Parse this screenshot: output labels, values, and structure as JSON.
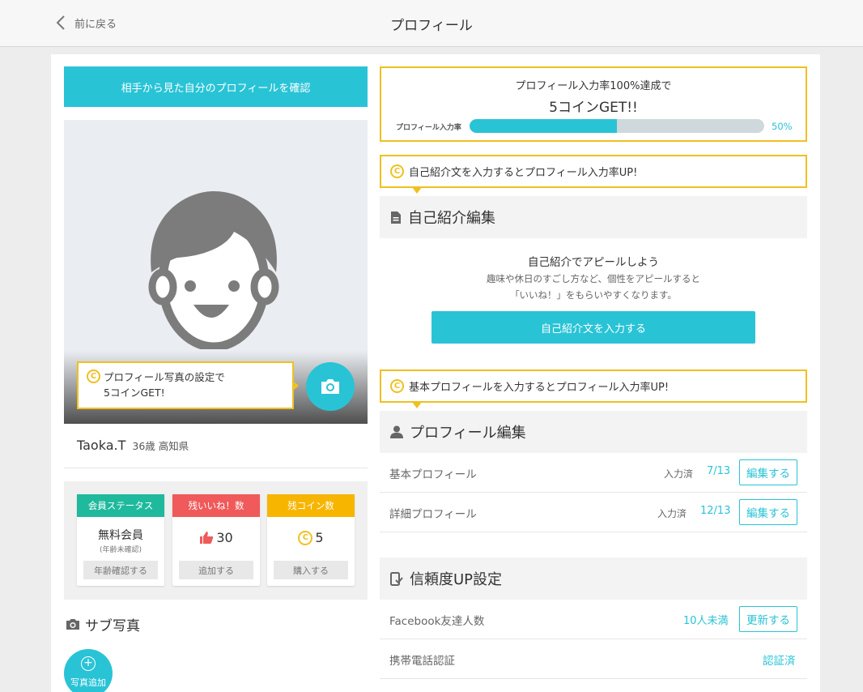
{
  "header": {
    "back_label": "前に戻る",
    "title": "プロフィール"
  },
  "left": {
    "view_profile_button": "相手から見た自分のプロフィールを確認",
    "photo_tip": {
      "line1": "プロフィール写真の設定で",
      "line2": "5コインGET!"
    },
    "user": {
      "name": "Taoka.T",
      "age_location": "36歳 高知県"
    },
    "stats": [
      {
        "header": "会員ステータス",
        "value": "無料会員",
        "sub": "(年齢未確認)",
        "action": "年齢確認する",
        "color": "#1fb99d"
      },
      {
        "header": "残いいね！数",
        "value": "30",
        "action": "追加する",
        "color": "#f05a5a"
      },
      {
        "header": "残コイン数",
        "value": "5",
        "action": "購入する",
        "color": "#f7b500"
      }
    ],
    "sub_photo_title": "サブ写真",
    "add_photo_label": "写真追加"
  },
  "right": {
    "progress": {
      "line1": "プロフィール入力率100%達成で",
      "line2": "5コインGET!!",
      "label": "プロフィール入力率",
      "percent_text": "50%",
      "fraction": 0.5
    },
    "intro_tip": "自己紹介文を入力するとプロフィール入力率UP!",
    "intro_section": {
      "title": "自己紹介編集",
      "line1": "自己紹介でアピールしよう",
      "line2": "趣味や休日のすごし方など、個性をアピールすると",
      "line3": "「いいね！」をもらいやすくなります。",
      "button": "自己紹介文を入力する"
    },
    "basic_tip": "基本プロフィールを入力するとプロフィール入力率UP!",
    "profile_section": {
      "title": "プロフィール編集",
      "rows": [
        {
          "label": "基本プロフィール",
          "status": "入力済",
          "count": "7/13",
          "action": "編集する"
        },
        {
          "label": "詳細プロフィール",
          "status": "入力済",
          "count": "12/13",
          "action": "編集する"
        }
      ]
    },
    "trust_section": {
      "title": "信頼度UP設定",
      "facebook": {
        "label": "Facebook友達人数",
        "value": "10人未満",
        "action": "更新する"
      },
      "phone": {
        "label": "携帯電話認証",
        "value": "認証済"
      }
    }
  },
  "colors": {
    "accent": "#29c3d6",
    "highlight": "#f0c020"
  }
}
